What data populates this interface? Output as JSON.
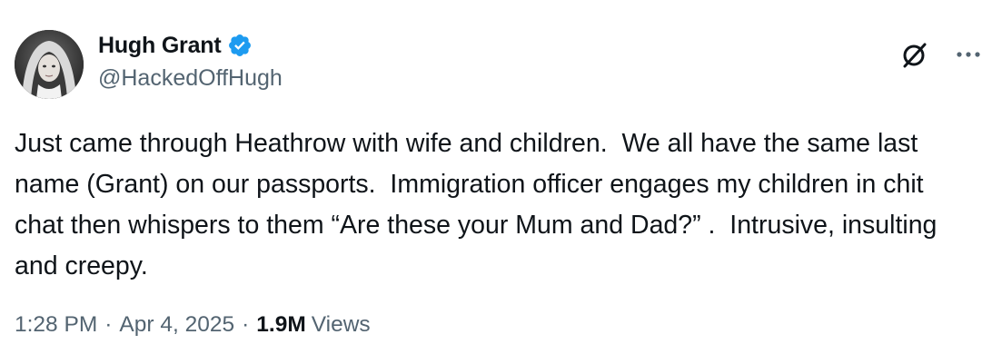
{
  "author": {
    "display_name": "Hugh Grant",
    "handle": "@HackedOffHugh",
    "verified": true,
    "avatar_icon": "profile-photo"
  },
  "actions": {
    "grok_icon": "grok-slash-icon",
    "more_icon": "more-horizontal-icon"
  },
  "tweet": {
    "text": "Just came through Heathrow with wife and children.  We all have the same last name (Grant) on our passports.  Immigration officer engages my children in chit chat then whispers to them “Are these your Mum and Dad?” .  Intrusive, insulting and creepy."
  },
  "meta": {
    "time": "1:28 PM",
    "separator": "·",
    "date": "Apr 4, 2025",
    "views_count": "1.9M",
    "views_label": "Views"
  },
  "colors": {
    "text_primary": "#0f1419",
    "text_secondary": "#536471",
    "verified_blue": "#1d9bf0",
    "background": "#ffffff"
  }
}
